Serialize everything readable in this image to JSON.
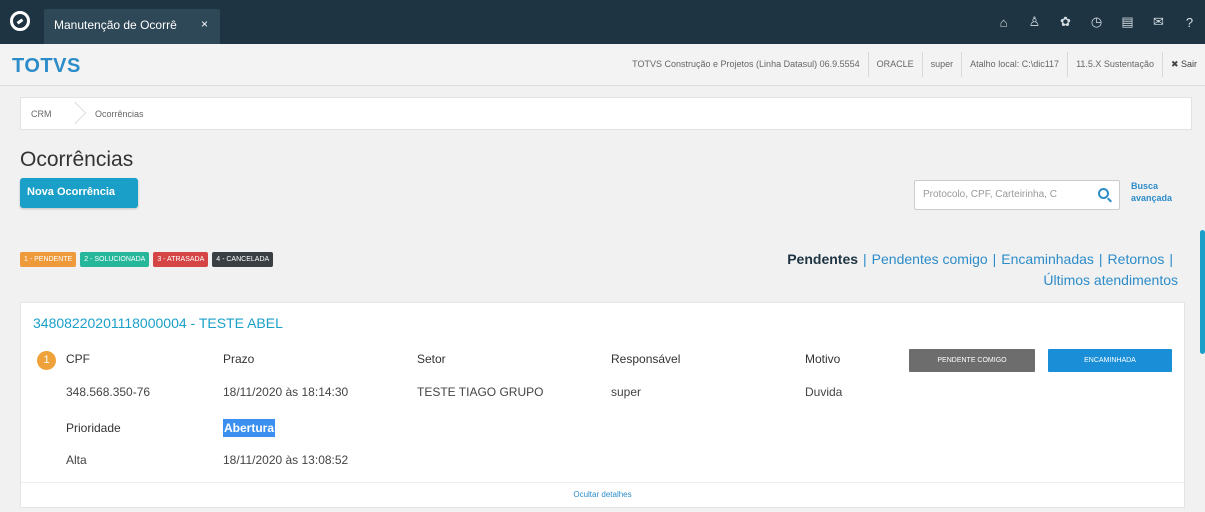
{
  "tab": {
    "title": "Manutenção de Ocorrê",
    "close": "×"
  },
  "top_icons": [
    {
      "name": "home-icon",
      "glyph": "⌂"
    },
    {
      "name": "sitemap-icon",
      "glyph": "♙"
    },
    {
      "name": "gear-icon",
      "glyph": "✿"
    },
    {
      "name": "clock-icon",
      "glyph": "◷"
    },
    {
      "name": "document-icon",
      "glyph": "▤"
    },
    {
      "name": "mail-icon",
      "glyph": "✉"
    },
    {
      "name": "help-icon",
      "glyph": "?"
    }
  ],
  "header": {
    "brand": "TOTVS",
    "company": "TOTVS Construção e Projetos (Linha Datasul) 06.9.5554",
    "database": "ORACLE",
    "user": "super",
    "shortcut": "Atalho local: C:\\dic117",
    "version": "11.5.X Sustentação",
    "logout": "✖ Sair"
  },
  "breadcrumb": [
    "CRM",
    "Ocorrências"
  ],
  "page": {
    "title": "Ocorrências",
    "new_button": "Nova Ocorrência",
    "search_placeholder": "Protocolo, CPF, Carteirinha, C",
    "advanced_search": "Busca avançada"
  },
  "legend": [
    {
      "label": "1 - PENDENTE",
      "color": "#ee9a3a"
    },
    {
      "label": "2 - SOLUCIONADA",
      "color": "#26b79a"
    },
    {
      "label": "3 - ATRASADA",
      "color": "#d64545"
    },
    {
      "label": "4 - CANCELADA",
      "color": "#3a3f44"
    }
  ],
  "filters": {
    "pendentes": "Pendentes",
    "pendentes_comigo": "Pendentes comigo",
    "encaminhadas": "Encaminhadas",
    "retornos": "Retornos",
    "ultimos": "Últimos atendimentos",
    "separator": "|"
  },
  "occurrence": {
    "title": "34808220201118000004 - TESTE ABEL",
    "priority_number": "1",
    "cpf_label": "CPF",
    "cpf": "348.568.350-76",
    "prazo_label": "Prazo",
    "prazo": "18/11/2020 às 18:14:30",
    "setor_label": "Setor",
    "setor": "TESTE TIAGO GRUPO",
    "responsavel_label": "Responsável",
    "responsavel": "super",
    "motivo_label": "Motivo",
    "motivo": "Duvida",
    "prioridade_label": "Prioridade",
    "prioridade": "Alta",
    "abertura_label": "Abertura",
    "abertura": "18/11/2020 às 13:08:52",
    "btn_pendente": "PENDENTE COMIGO",
    "btn_encaminhada": "ENCAMINHADA",
    "hide_details": "Ocultar detalhes"
  }
}
